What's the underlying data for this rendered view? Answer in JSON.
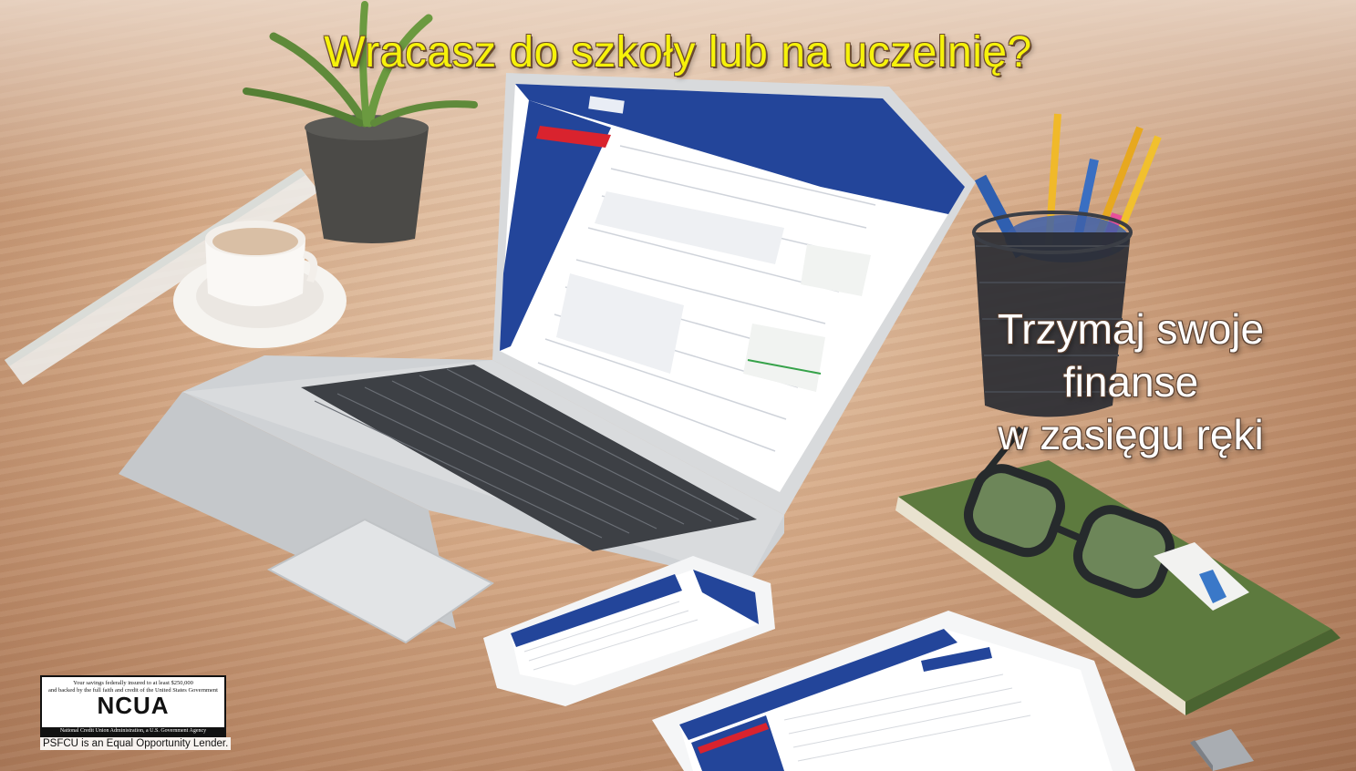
{
  "headline": "Wracasz do szkoły lub na uczelnię?",
  "tagline": [
    "Trzymaj swoje",
    "finanse",
    "w zasięgu ręki"
  ],
  "ncua": {
    "notice_line1": "Your savings federally insured to at least $250,000",
    "notice_line2": "and backed by the full faith and credit of the United States Government",
    "logo": "NCUA",
    "agency": "National Credit Union Administration, a U.S. Government Agency"
  },
  "equal_lender": "PSFCU is an Equal Opportunity Lender.",
  "scene": {
    "objects": [
      "laptop",
      "smartphone",
      "tablet",
      "coffee-cup",
      "potted-plant",
      "pencil-cup",
      "notebook",
      "glasses",
      "usb-drive",
      "ruler",
      "sharpener"
    ],
    "colors": {
      "headline": "#f6f20a",
      "brand_blue": "#23459a",
      "brand_red": "#d9232e",
      "desk": "#d6ab88"
    }
  }
}
